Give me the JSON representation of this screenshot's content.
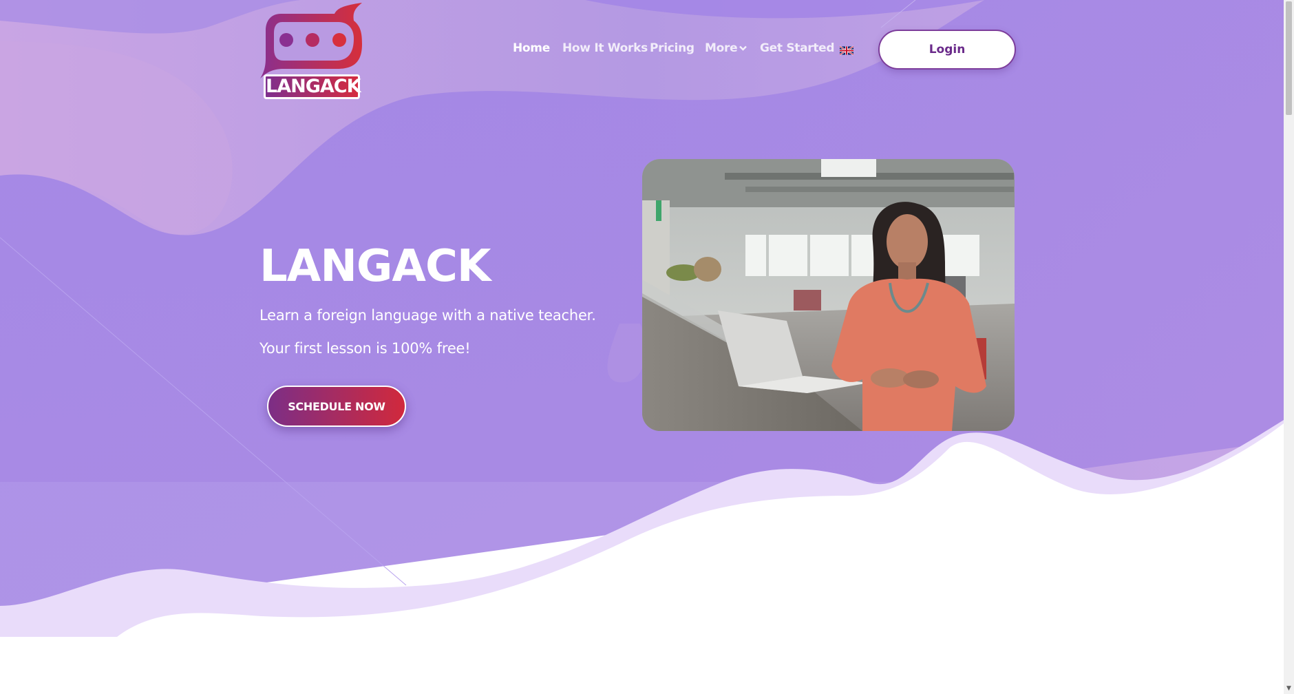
{
  "brand": {
    "name": "LANGACK"
  },
  "nav": {
    "items": [
      {
        "label": "Home",
        "active": true
      },
      {
        "label": "How It Works",
        "active": false
      },
      {
        "label": "Pricing",
        "active": false
      },
      {
        "label": "More",
        "active": false
      },
      {
        "label": "Get Started",
        "active": false
      }
    ],
    "language_icon": "uk-flag-icon",
    "login_label": "Login"
  },
  "hero": {
    "title": "LANGACK",
    "subtitle": "Learn a foreign language with a native teacher.",
    "offer": "Your first lesson is 100% free!",
    "cta_label": "SCHEDULE NOW"
  },
  "colors": {
    "hero_bg": "#a587e5",
    "accent_purple": "#7c2e86",
    "accent_red": "#d1293c",
    "light_wave": "#e9dcfa"
  }
}
